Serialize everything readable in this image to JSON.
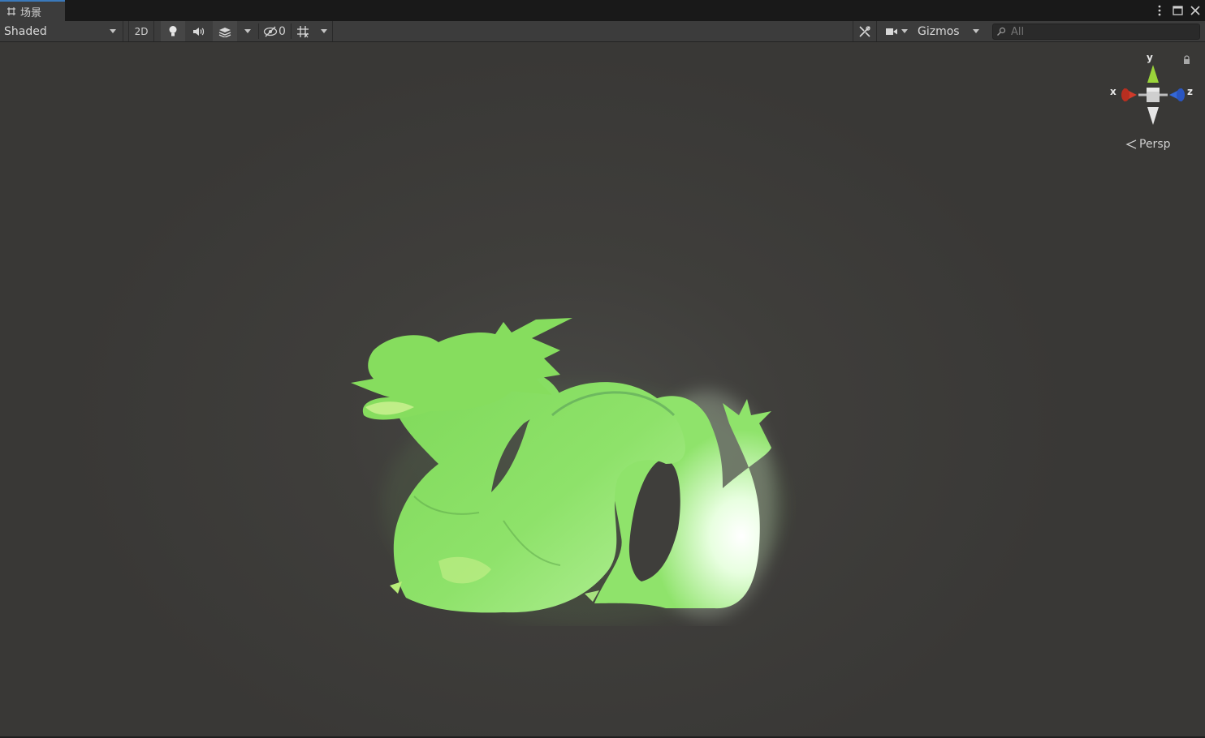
{
  "tab": {
    "title": "场景",
    "icon": "scene-grid-icon"
  },
  "window_buttons": [
    "more-options-icon",
    "maximize-icon",
    "close-icon"
  ],
  "toolbar": {
    "shading_mode": "Shaded",
    "mode_2d_label": "2D",
    "lighting_icon": "bulb-icon",
    "audio_icon": "speaker-icon",
    "effects_icon": "effects-layers-icon",
    "hidden_count": "0",
    "grid_icon": "grid-icon",
    "tools_icon": "tools-icon",
    "camera_icon": "camera-icon",
    "gizmos_label": "Gizmos",
    "search_placeholder": "All"
  },
  "orientation_gizmo": {
    "x_label": "x",
    "y_label": "y",
    "z_label": "z",
    "projection": "Persp",
    "colors": {
      "x": "#d03a2a",
      "y": "#9ad43a",
      "z": "#3468d8"
    }
  },
  "scene": {
    "object": "dragon",
    "color": "#8ee26a"
  }
}
